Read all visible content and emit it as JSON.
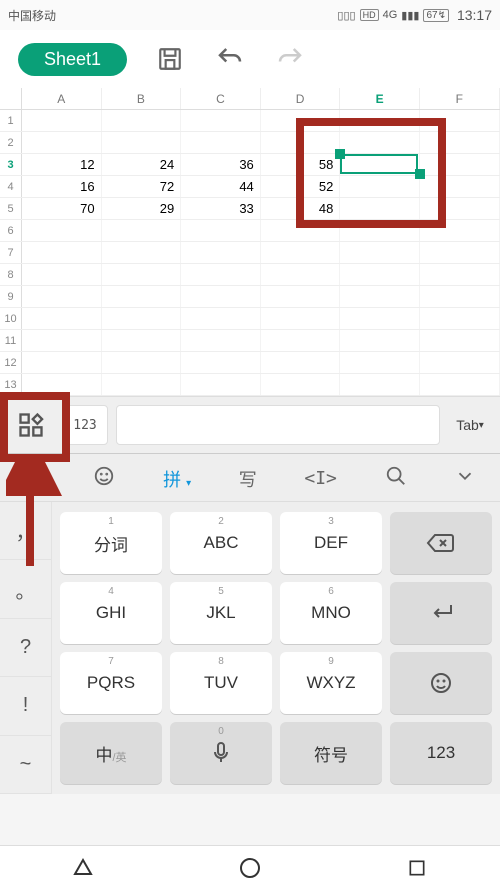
{
  "status": {
    "carrier": "中国移动",
    "network": "4G",
    "battery": "67",
    "time": "13:17"
  },
  "toolbar": {
    "sheet_name": "Sheet1"
  },
  "sheet": {
    "columns": [
      "A",
      "B",
      "C",
      "D",
      "E",
      "F"
    ],
    "selected_col_index": 4,
    "rows": [
      {
        "n": "1",
        "cells": [
          "",
          "",
          "",
          "",
          "",
          ""
        ]
      },
      {
        "n": "2",
        "cells": [
          "",
          "",
          "",
          "",
          "",
          ""
        ]
      },
      {
        "n": "3",
        "cells": [
          "12",
          "24",
          "36",
          "58",
          "",
          ""
        ],
        "selected": true
      },
      {
        "n": "4",
        "cells": [
          "16",
          "72",
          "44",
          "52",
          "",
          ""
        ]
      },
      {
        "n": "5",
        "cells": [
          "70",
          "29",
          "33",
          "48",
          "",
          ""
        ]
      },
      {
        "n": "6",
        "cells": [
          "",
          "",
          "",
          "",
          "",
          ""
        ]
      },
      {
        "n": "7",
        "cells": [
          "",
          "",
          "",
          "",
          "",
          ""
        ]
      },
      {
        "n": "8",
        "cells": [
          "",
          "",
          "",
          "",
          "",
          ""
        ]
      },
      {
        "n": "9",
        "cells": [
          "",
          "",
          "",
          "",
          "",
          ""
        ]
      },
      {
        "n": "10",
        "cells": [
          "",
          "",
          "",
          "",
          "",
          ""
        ]
      },
      {
        "n": "11",
        "cells": [
          "",
          "",
          "",
          "",
          "",
          ""
        ]
      },
      {
        "n": "12",
        "cells": [
          "",
          "",
          "",
          "",
          "",
          ""
        ]
      },
      {
        "n": "13",
        "cells": [
          "",
          "",
          "",
          "",
          "",
          ""
        ]
      }
    ]
  },
  "formula_bar": {
    "num_mode": "123",
    "value": "",
    "tab_label": "Tab"
  },
  "keyboard": {
    "top": {
      "emoji": "☺",
      "pinyin": "拼",
      "hand": "写",
      "clip": "〈I〉",
      "search": "🔍",
      "collapse": "⌄"
    },
    "left": [
      "，",
      "。",
      "?",
      "!",
      "~"
    ],
    "rows": [
      [
        {
          "s": "1",
          "m": "分词"
        },
        {
          "s": "2",
          "m": "ABC"
        },
        {
          "s": "3",
          "m": "DEF"
        },
        {
          "icon": "backspace"
        }
      ],
      [
        {
          "s": "4",
          "m": "GHI"
        },
        {
          "s": "5",
          "m": "JKL"
        },
        {
          "s": "6",
          "m": "MNO"
        },
        {
          "icon": "enter"
        }
      ],
      [
        {
          "s": "7",
          "m": "PQRS"
        },
        {
          "s": "8",
          "m": "TUV"
        },
        {
          "s": "9",
          "m": "WXYZ"
        },
        {
          "icon": "emoji"
        }
      ],
      [
        {
          "m": "中",
          "sub": "/英",
          "gray": true
        },
        {
          "icon": "mic",
          "gray": true,
          "s": "0"
        },
        {
          "m": "符号",
          "gray": true
        },
        {
          "m": "123",
          "gray": true
        }
      ]
    ]
  }
}
